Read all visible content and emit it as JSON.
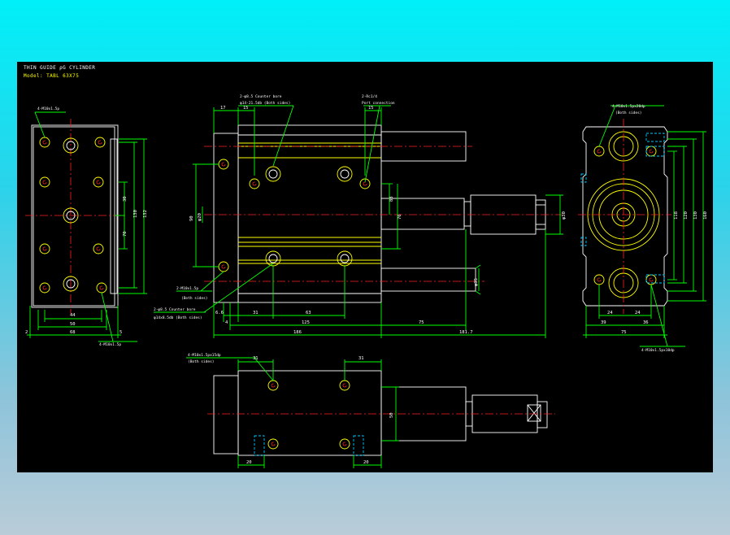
{
  "header": {
    "title": "THIN GUIDE ρG CYLINDER",
    "model": "Model: TABL 63X75"
  },
  "dimensions": {
    "d2": "2",
    "d44": "44",
    "d50": "50",
    "d68": "68",
    "d5": "5",
    "d70": "70",
    "d30": "30",
    "d130": "130",
    "d132": "132",
    "d17": "17",
    "d15a": "15",
    "d15b": "15",
    "d90": "90",
    "d20": "φ20",
    "d88": "88",
    "d76": "76",
    "d30b": "φ30",
    "d35": "φ35",
    "d6": "6.6",
    "d4": "4",
    "d31": "31",
    "d63": "63",
    "d125": "125",
    "d186": "186",
    "d75": "75",
    "d1817": "181.7",
    "d118": "118",
    "d120": "120",
    "d130b": "130",
    "d160": "160",
    "d24a": "24",
    "d24b": "24",
    "d39": "39",
    "d36": "36",
    "d75b": "75",
    "d31c": "31",
    "d31d": "31",
    "d50b": "50",
    "d20a": "20",
    "d20b": "20"
  },
  "callouts": {
    "front_top": "4-M10x1.5p",
    "front_bottom": "4-M10x1.5p",
    "side_top1": "2-φ8.5 Counter bore",
    "side_top1b": "φ14-21.5db (Both sides)",
    "side_top2": "2-Rc1/4",
    "side_top2b": "Port connection",
    "side_mid1": "2-M10x1.5p",
    "side_mid1b": "(Both sides)",
    "side_mid2": "2-φ8.5 Counter bore",
    "side_mid2b": "φ14x8.5db (Both sides)",
    "right_top": "4-M10x1.5px20dp",
    "right_topb": "(Both sides)",
    "right_bottom": "4-M10x1.5px10dp",
    "bottom_top": "4-M10x1.5px15dp",
    "bottom_topb": "(Both sides)"
  },
  "colors": {
    "outline": "#ffffff",
    "dimension": "#00ff00",
    "hidden": "#ffff00",
    "center": "#ff2020",
    "detail": "#00c8ff"
  }
}
